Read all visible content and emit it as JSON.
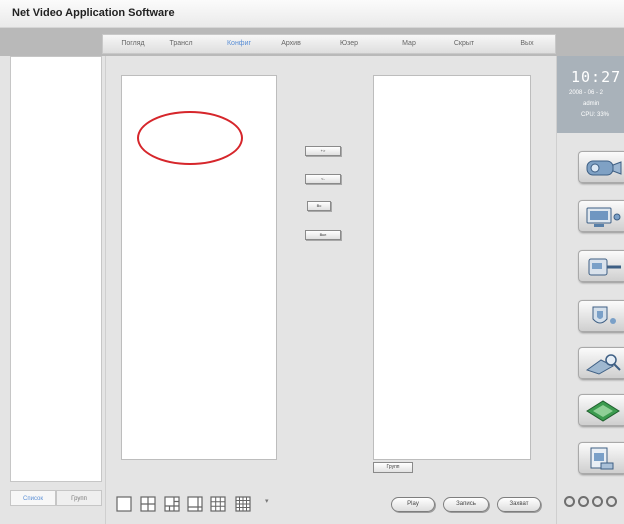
{
  "app": {
    "title": "Net Video Application Software"
  },
  "menu": {
    "items": [
      {
        "label": "Погляд"
      },
      {
        "label": "Трансл"
      },
      {
        "label": "Конфиг",
        "active": true
      },
      {
        "label": "Архив"
      },
      {
        "label": "Юзер"
      },
      {
        "label": "Мар"
      },
      {
        "label": "Скрыт"
      },
      {
        "label": "Вых"
      }
    ]
  },
  "status": {
    "time": "10:27:3",
    "date": "2008 - 06 - 2",
    "user": "admin",
    "cpu": "CPU: 33%"
  },
  "transfer_buttons": {
    "add": "+>",
    "remove": "<-",
    "all": "Вс",
    "clear": "Вкл"
  },
  "group_button": "Групп",
  "left_tabs": {
    "list": "Список",
    "group": "Групп"
  },
  "bottom": {
    "play": "Play",
    "record": "Запись",
    "snapshot": "Захват"
  },
  "colors": {
    "annotation": "#d6262b",
    "active_menu": "#5a8fd6"
  },
  "side_icons": [
    "camera-icon",
    "monitor-icon",
    "network-icon",
    "shield-icon",
    "search-icon",
    "card-icon",
    "document-icon"
  ]
}
